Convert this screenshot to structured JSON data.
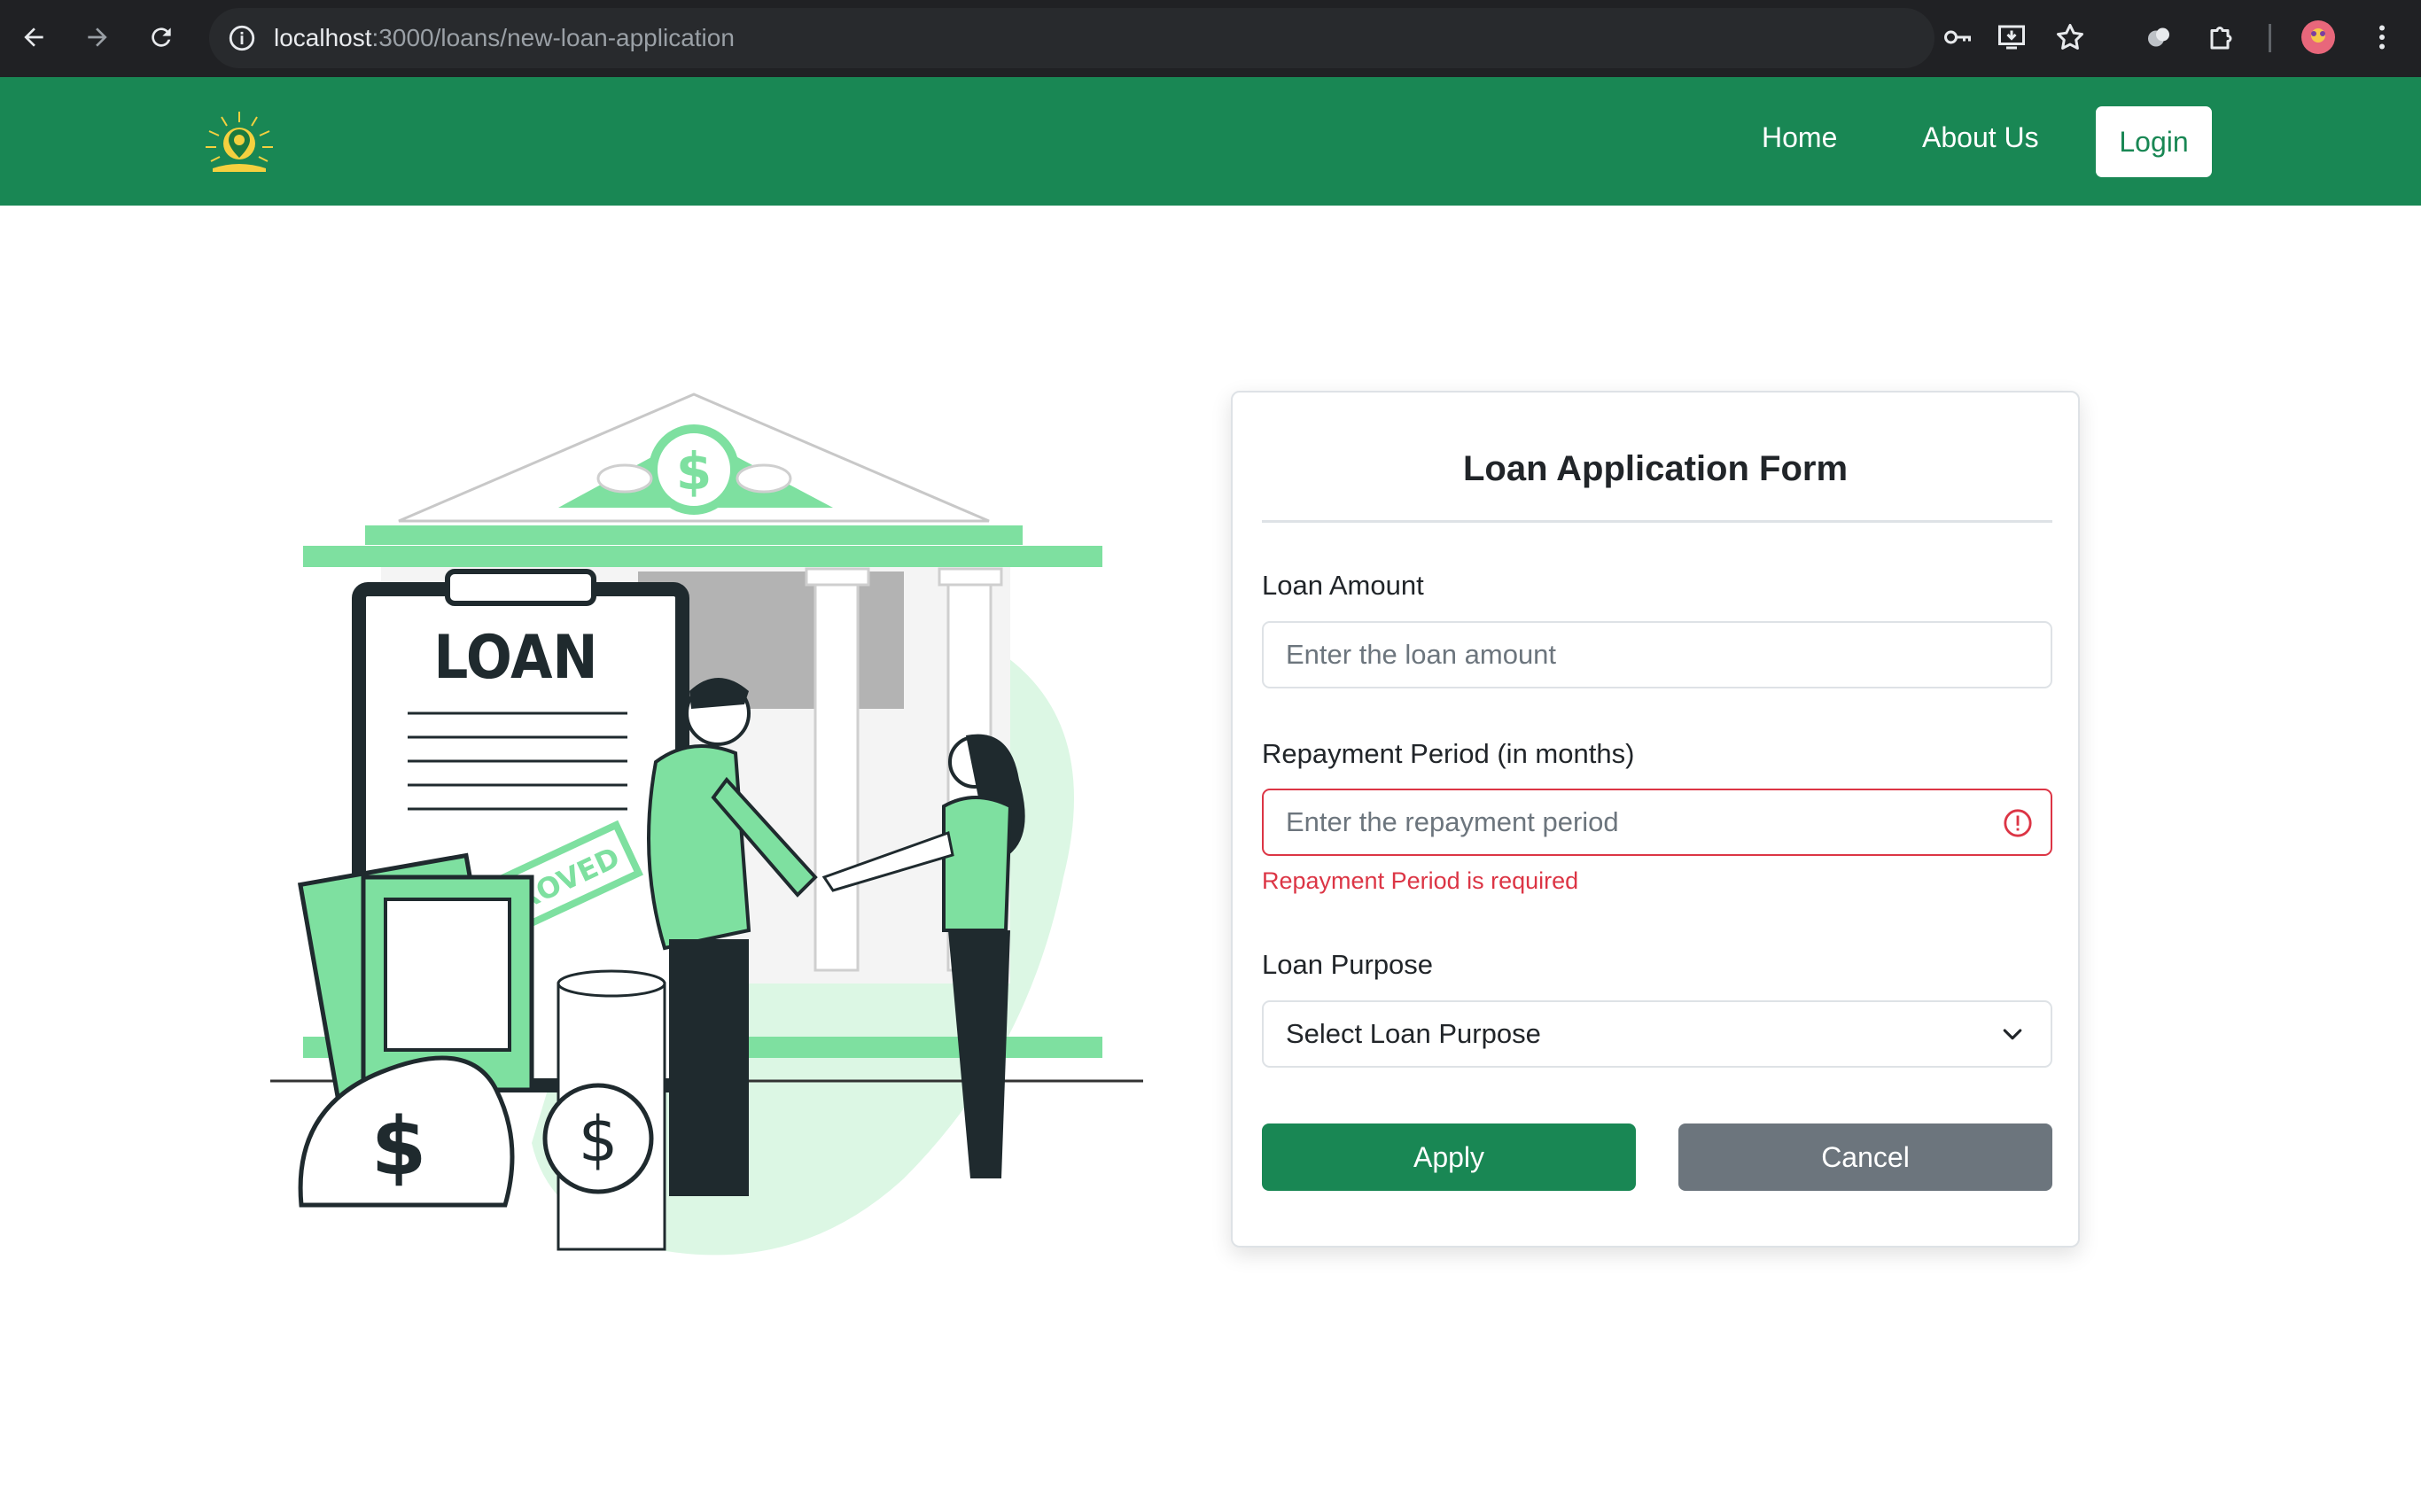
{
  "browser": {
    "url_host": "localhost",
    "url_path": ":3000/loans/new-loan-application",
    "icons": [
      "back-arrow-icon",
      "forward-arrow-icon",
      "reload-icon",
      "site-info-icon",
      "key-icon",
      "install-app-icon",
      "bookmark-star-icon",
      "extension-puzzle-icon",
      "profile-avatar-icon",
      "menu-kebab-icon"
    ]
  },
  "navbar": {
    "links": [
      {
        "label": "Home"
      },
      {
        "label": "About Us"
      }
    ],
    "login_label": "Login",
    "brand_color": "#198754"
  },
  "illustration": {
    "sign_text": "LOAN",
    "stamp_text": "ROVED"
  },
  "form": {
    "title": "Loan Application Form",
    "loan_amount": {
      "label": "Loan Amount",
      "placeholder": "Enter the loan amount",
      "value": ""
    },
    "repayment_period": {
      "label": "Repayment Period (in months)",
      "placeholder": "Enter the repayment period",
      "value": "",
      "error": "Repayment Period is required"
    },
    "loan_purpose": {
      "label": "Loan Purpose",
      "selected": "Select Loan Purpose"
    },
    "apply_label": "Apply",
    "cancel_label": "Cancel"
  },
  "colors": {
    "primary": "#198754",
    "danger": "#dc3545",
    "secondary": "#6c757d",
    "illustration_green": "#7ee0a0"
  }
}
